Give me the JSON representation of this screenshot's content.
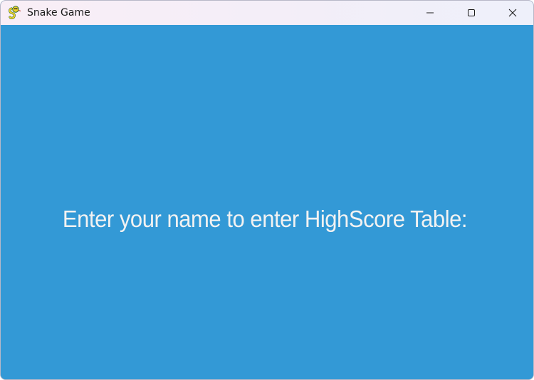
{
  "window": {
    "title": "Snake Game",
    "app_icon": "pygame-snake-icon",
    "controls": {
      "minimize_icon": "minimize-icon",
      "maximize_icon": "maximize-icon",
      "close_icon": "close-icon"
    }
  },
  "game": {
    "background_color": "#3399d6",
    "prompt_text": "Enter your name to enter HighScore Table:",
    "prompt_color": "#f2f2f2"
  }
}
